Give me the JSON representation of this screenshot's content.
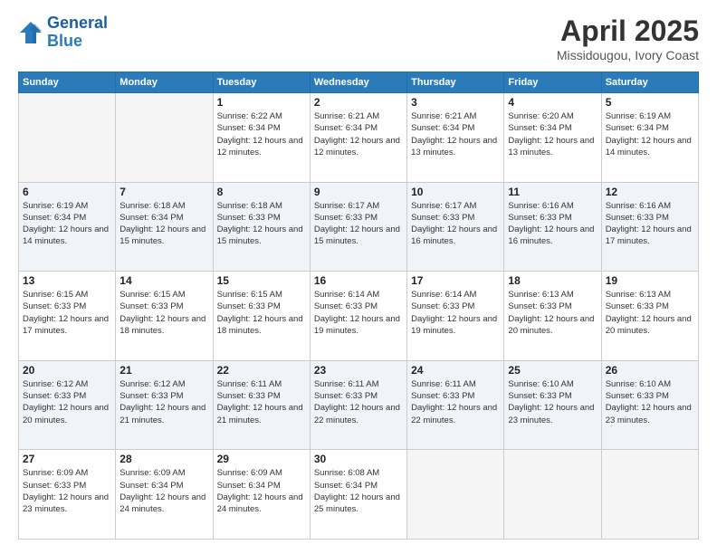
{
  "header": {
    "logo_line1": "General",
    "logo_line2": "Blue",
    "title": "April 2025",
    "subtitle": "Missidougou, Ivory Coast"
  },
  "days_of_week": [
    "Sunday",
    "Monday",
    "Tuesday",
    "Wednesday",
    "Thursday",
    "Friday",
    "Saturday"
  ],
  "weeks": [
    [
      {
        "day": "",
        "info": ""
      },
      {
        "day": "",
        "info": ""
      },
      {
        "day": "1",
        "info": "Sunrise: 6:22 AM\nSunset: 6:34 PM\nDaylight: 12 hours and 12 minutes."
      },
      {
        "day": "2",
        "info": "Sunrise: 6:21 AM\nSunset: 6:34 PM\nDaylight: 12 hours and 12 minutes."
      },
      {
        "day": "3",
        "info": "Sunrise: 6:21 AM\nSunset: 6:34 PM\nDaylight: 12 hours and 13 minutes."
      },
      {
        "day": "4",
        "info": "Sunrise: 6:20 AM\nSunset: 6:34 PM\nDaylight: 12 hours and 13 minutes."
      },
      {
        "day": "5",
        "info": "Sunrise: 6:19 AM\nSunset: 6:34 PM\nDaylight: 12 hours and 14 minutes."
      }
    ],
    [
      {
        "day": "6",
        "info": "Sunrise: 6:19 AM\nSunset: 6:34 PM\nDaylight: 12 hours and 14 minutes."
      },
      {
        "day": "7",
        "info": "Sunrise: 6:18 AM\nSunset: 6:34 PM\nDaylight: 12 hours and 15 minutes."
      },
      {
        "day": "8",
        "info": "Sunrise: 6:18 AM\nSunset: 6:33 PM\nDaylight: 12 hours and 15 minutes."
      },
      {
        "day": "9",
        "info": "Sunrise: 6:17 AM\nSunset: 6:33 PM\nDaylight: 12 hours and 15 minutes."
      },
      {
        "day": "10",
        "info": "Sunrise: 6:17 AM\nSunset: 6:33 PM\nDaylight: 12 hours and 16 minutes."
      },
      {
        "day": "11",
        "info": "Sunrise: 6:16 AM\nSunset: 6:33 PM\nDaylight: 12 hours and 16 minutes."
      },
      {
        "day": "12",
        "info": "Sunrise: 6:16 AM\nSunset: 6:33 PM\nDaylight: 12 hours and 17 minutes."
      }
    ],
    [
      {
        "day": "13",
        "info": "Sunrise: 6:15 AM\nSunset: 6:33 PM\nDaylight: 12 hours and 17 minutes."
      },
      {
        "day": "14",
        "info": "Sunrise: 6:15 AM\nSunset: 6:33 PM\nDaylight: 12 hours and 18 minutes."
      },
      {
        "day": "15",
        "info": "Sunrise: 6:15 AM\nSunset: 6:33 PM\nDaylight: 12 hours and 18 minutes."
      },
      {
        "day": "16",
        "info": "Sunrise: 6:14 AM\nSunset: 6:33 PM\nDaylight: 12 hours and 19 minutes."
      },
      {
        "day": "17",
        "info": "Sunrise: 6:14 AM\nSunset: 6:33 PM\nDaylight: 12 hours and 19 minutes."
      },
      {
        "day": "18",
        "info": "Sunrise: 6:13 AM\nSunset: 6:33 PM\nDaylight: 12 hours and 20 minutes."
      },
      {
        "day": "19",
        "info": "Sunrise: 6:13 AM\nSunset: 6:33 PM\nDaylight: 12 hours and 20 minutes."
      }
    ],
    [
      {
        "day": "20",
        "info": "Sunrise: 6:12 AM\nSunset: 6:33 PM\nDaylight: 12 hours and 20 minutes."
      },
      {
        "day": "21",
        "info": "Sunrise: 6:12 AM\nSunset: 6:33 PM\nDaylight: 12 hours and 21 minutes."
      },
      {
        "day": "22",
        "info": "Sunrise: 6:11 AM\nSunset: 6:33 PM\nDaylight: 12 hours and 21 minutes."
      },
      {
        "day": "23",
        "info": "Sunrise: 6:11 AM\nSunset: 6:33 PM\nDaylight: 12 hours and 22 minutes."
      },
      {
        "day": "24",
        "info": "Sunrise: 6:11 AM\nSunset: 6:33 PM\nDaylight: 12 hours and 22 minutes."
      },
      {
        "day": "25",
        "info": "Sunrise: 6:10 AM\nSunset: 6:33 PM\nDaylight: 12 hours and 23 minutes."
      },
      {
        "day": "26",
        "info": "Sunrise: 6:10 AM\nSunset: 6:33 PM\nDaylight: 12 hours and 23 minutes."
      }
    ],
    [
      {
        "day": "27",
        "info": "Sunrise: 6:09 AM\nSunset: 6:33 PM\nDaylight: 12 hours and 23 minutes."
      },
      {
        "day": "28",
        "info": "Sunrise: 6:09 AM\nSunset: 6:34 PM\nDaylight: 12 hours and 24 minutes."
      },
      {
        "day": "29",
        "info": "Sunrise: 6:09 AM\nSunset: 6:34 PM\nDaylight: 12 hours and 24 minutes."
      },
      {
        "day": "30",
        "info": "Sunrise: 6:08 AM\nSunset: 6:34 PM\nDaylight: 12 hours and 25 minutes."
      },
      {
        "day": "",
        "info": ""
      },
      {
        "day": "",
        "info": ""
      },
      {
        "day": "",
        "info": ""
      }
    ]
  ]
}
